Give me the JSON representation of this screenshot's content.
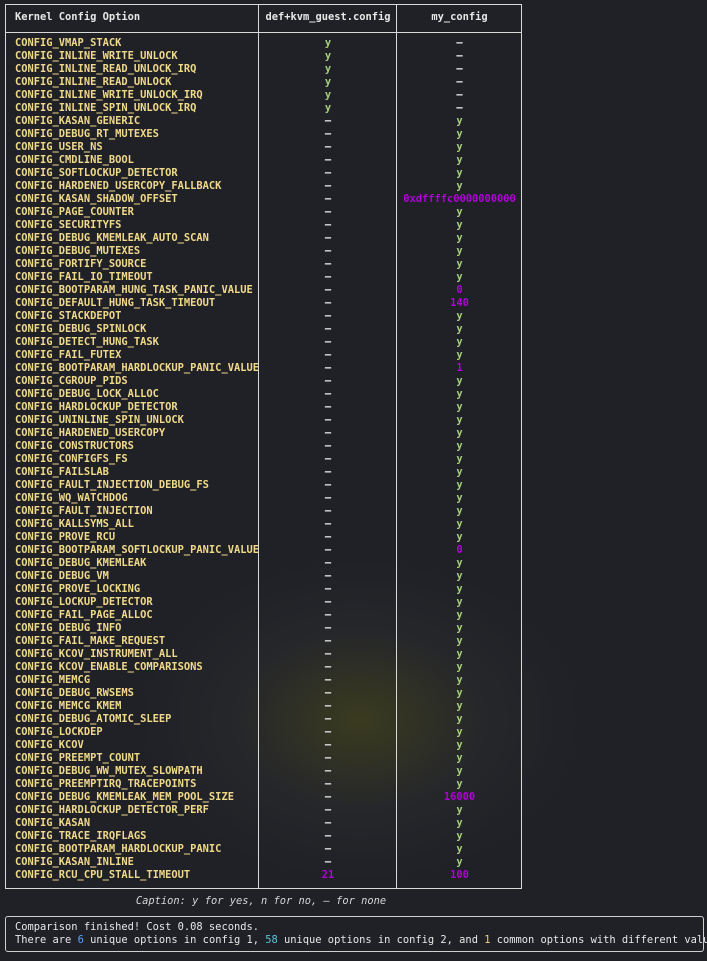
{
  "table": {
    "headers": [
      "Kernel Config Option",
      "def+kvm_guest.config",
      "my_config"
    ],
    "rows": [
      [
        "CONFIG_VMAP_STACK",
        "y",
        "–"
      ],
      [
        "CONFIG_INLINE_WRITE_UNLOCK",
        "y",
        "–"
      ],
      [
        "CONFIG_INLINE_READ_UNLOCK_IRQ",
        "y",
        "–"
      ],
      [
        "CONFIG_INLINE_READ_UNLOCK",
        "y",
        "–"
      ],
      [
        "CONFIG_INLINE_WRITE_UNLOCK_IRQ",
        "y",
        "–"
      ],
      [
        "CONFIG_INLINE_SPIN_UNLOCK_IRQ",
        "y",
        "–"
      ],
      [
        "CONFIG_KASAN_GENERIC",
        "–",
        "y"
      ],
      [
        "CONFIG_DEBUG_RT_MUTEXES",
        "–",
        "y"
      ],
      [
        "CONFIG_USER_NS",
        "–",
        "y"
      ],
      [
        "CONFIG_CMDLINE_BOOL",
        "–",
        "y"
      ],
      [
        "CONFIG_SOFTLOCKUP_DETECTOR",
        "–",
        "y"
      ],
      [
        "CONFIG_HARDENED_USERCOPY_FALLBACK",
        "–",
        "y"
      ],
      [
        "CONFIG_KASAN_SHADOW_OFFSET",
        "–",
        "0xdffffc0000000000"
      ],
      [
        "CONFIG_PAGE_COUNTER",
        "–",
        "y"
      ],
      [
        "CONFIG_SECURITYFS",
        "–",
        "y"
      ],
      [
        "CONFIG_DEBUG_KMEMLEAK_AUTO_SCAN",
        "–",
        "y"
      ],
      [
        "CONFIG_DEBUG_MUTEXES",
        "–",
        "y"
      ],
      [
        "CONFIG_FORTIFY_SOURCE",
        "–",
        "y"
      ],
      [
        "CONFIG_FAIL_IO_TIMEOUT",
        "–",
        "y"
      ],
      [
        "CONFIG_BOOTPARAM_HUNG_TASK_PANIC_VALUE",
        "–",
        "0"
      ],
      [
        "CONFIG_DEFAULT_HUNG_TASK_TIMEOUT",
        "–",
        "140"
      ],
      [
        "CONFIG_STACKDEPOT",
        "–",
        "y"
      ],
      [
        "CONFIG_DEBUG_SPINLOCK",
        "–",
        "y"
      ],
      [
        "CONFIG_DETECT_HUNG_TASK",
        "–",
        "y"
      ],
      [
        "CONFIG_FAIL_FUTEX",
        "–",
        "y"
      ],
      [
        "CONFIG_BOOTPARAM_HARDLOCKUP_PANIC_VALUE",
        "–",
        "1"
      ],
      [
        "CONFIG_CGROUP_PIDS",
        "–",
        "y"
      ],
      [
        "CONFIG_DEBUG_LOCK_ALLOC",
        "–",
        "y"
      ],
      [
        "CONFIG_HARDLOCKUP_DETECTOR",
        "–",
        "y"
      ],
      [
        "CONFIG_UNINLINE_SPIN_UNLOCK",
        "–",
        "y"
      ],
      [
        "CONFIG_HARDENED_USERCOPY",
        "–",
        "y"
      ],
      [
        "CONFIG_CONSTRUCTORS",
        "–",
        "y"
      ],
      [
        "CONFIG_CONFIGFS_FS",
        "–",
        "y"
      ],
      [
        "CONFIG_FAILSLAB",
        "–",
        "y"
      ],
      [
        "CONFIG_FAULT_INJECTION_DEBUG_FS",
        "–",
        "y"
      ],
      [
        "CONFIG_WQ_WATCHDOG",
        "–",
        "y"
      ],
      [
        "CONFIG_FAULT_INJECTION",
        "–",
        "y"
      ],
      [
        "CONFIG_KALLSYMS_ALL",
        "–",
        "y"
      ],
      [
        "CONFIG_PROVE_RCU",
        "–",
        "y"
      ],
      [
        "CONFIG_BOOTPARAM_SOFTLOCKUP_PANIC_VALUE",
        "–",
        "0"
      ],
      [
        "CONFIG_DEBUG_KMEMLEAK",
        "–",
        "y"
      ],
      [
        "CONFIG_DEBUG_VM",
        "–",
        "y"
      ],
      [
        "CONFIG_PROVE_LOCKING",
        "–",
        "y"
      ],
      [
        "CONFIG_LOCKUP_DETECTOR",
        "–",
        "y"
      ],
      [
        "CONFIG_FAIL_PAGE_ALLOC",
        "–",
        "y"
      ],
      [
        "CONFIG_DEBUG_INFO",
        "–",
        "y"
      ],
      [
        "CONFIG_FAIL_MAKE_REQUEST",
        "–",
        "y"
      ],
      [
        "CONFIG_KCOV_INSTRUMENT_ALL",
        "–",
        "y"
      ],
      [
        "CONFIG_KCOV_ENABLE_COMPARISONS",
        "–",
        "y"
      ],
      [
        "CONFIG_MEMCG",
        "–",
        "y"
      ],
      [
        "CONFIG_DEBUG_RWSEMS",
        "–",
        "y"
      ],
      [
        "CONFIG_MEMCG_KMEM",
        "–",
        "y"
      ],
      [
        "CONFIG_DEBUG_ATOMIC_SLEEP",
        "–",
        "y"
      ],
      [
        "CONFIG_LOCKDEP",
        "–",
        "y"
      ],
      [
        "CONFIG_KCOV",
        "–",
        "y"
      ],
      [
        "CONFIG_PREEMPT_COUNT",
        "–",
        "y"
      ],
      [
        "CONFIG_DEBUG_WW_MUTEX_SLOWPATH",
        "–",
        "y"
      ],
      [
        "CONFIG_PREEMPTIRQ_TRACEPOINTS",
        "–",
        "y"
      ],
      [
        "CONFIG_DEBUG_KMEMLEAK_MEM_POOL_SIZE",
        "–",
        "16000"
      ],
      [
        "CONFIG_HARDLOCKUP_DETECTOR_PERF",
        "–",
        "y"
      ],
      [
        "CONFIG_KASAN",
        "–",
        "y"
      ],
      [
        "CONFIG_TRACE_IRQFLAGS",
        "–",
        "y"
      ],
      [
        "CONFIG_BOOTPARAM_HARDLOCKUP_PANIC",
        "–",
        "y"
      ],
      [
        "CONFIG_KASAN_INLINE",
        "–",
        "y"
      ],
      [
        "CONFIG_RCU_CPU_STALL_TIMEOUT",
        "21",
        "100"
      ]
    ]
  },
  "caption": "Caption: y for yes, n for no, – for none",
  "summary": {
    "line1": "Comparison finished! Cost 0.08 seconds.",
    "line2_parts": [
      "There are ",
      "6",
      " unique options in config 1, ",
      "58",
      " unique options in config 2, and ",
      "1",
      " common options with different values."
    ]
  },
  "colors": {
    "option_name": "#f0d98a",
    "yes_value": "#a7d07a",
    "numeric_value": "#b000d8",
    "count_config1": "#58a6ff",
    "count_config2": "#56c7d6",
    "count_common": "#f3d56b"
  }
}
